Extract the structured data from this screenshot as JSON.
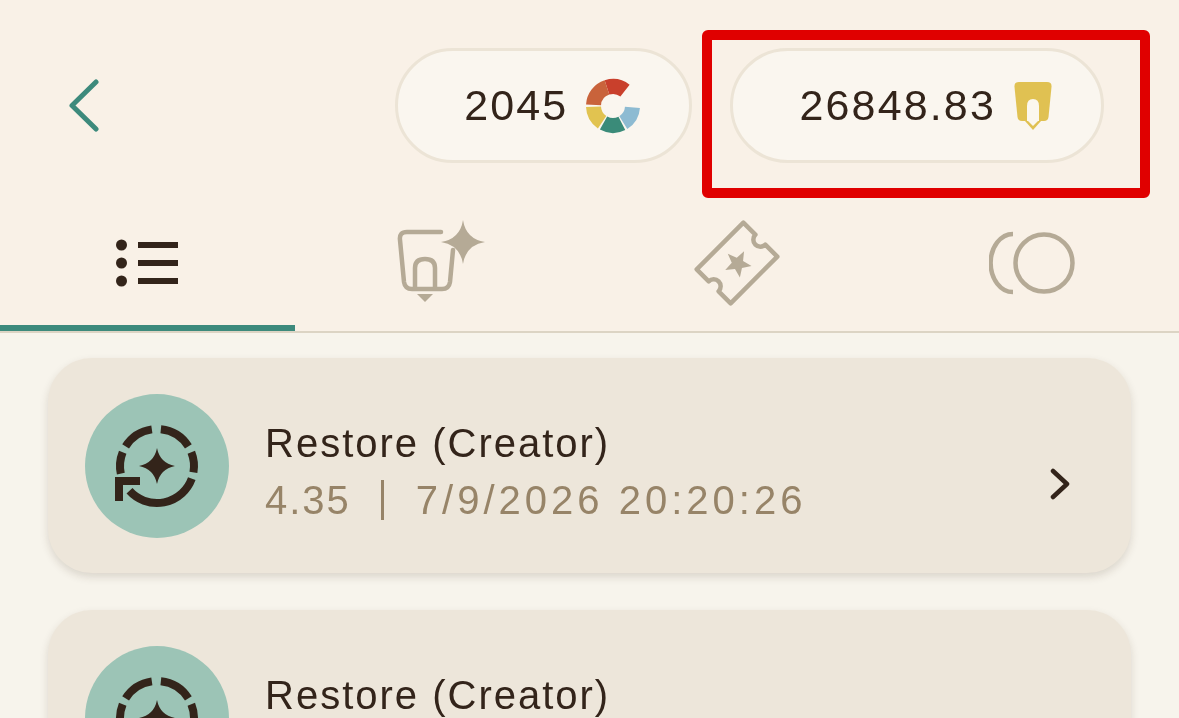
{
  "balances": [
    {
      "kind": "palette",
      "amount": "2045",
      "highlighted": false
    },
    {
      "kind": "pencil",
      "amount": "26848.83",
      "highlighted": true
    }
  ],
  "tabs": [
    {
      "kind": "list",
      "selected": true
    },
    {
      "kind": "pencil-sparkle",
      "selected": false
    },
    {
      "kind": "ticket",
      "selected": false
    },
    {
      "kind": "circles",
      "selected": false
    }
  ],
  "transactions": [
    {
      "title": "Restore (Creator)",
      "amount": "4.35",
      "date": "7/9/2026 20:20:26"
    },
    {
      "title": "Restore (Creator)"
    }
  ]
}
